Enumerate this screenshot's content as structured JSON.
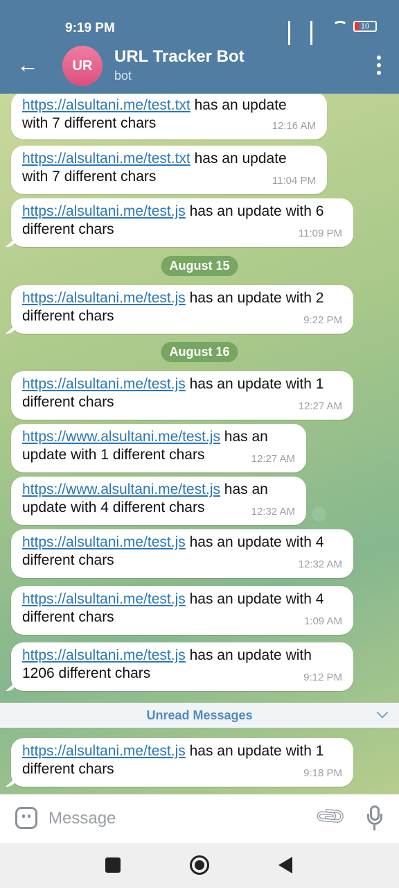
{
  "status_bar": {
    "time": "9:19 PM",
    "battery": "10"
  },
  "header": {
    "avatar_initials": "UR",
    "title": "URL Tracker Bot",
    "subtitle": "bot"
  },
  "messages": [
    {
      "link": "https://alsultani.me/test.txt",
      "text": " has an update with 7 different chars",
      "time": "12:16 AM"
    },
    {
      "link": "https://alsultani.me/test.txt",
      "text": " has an update with 7 different chars",
      "time": "11:04 PM"
    },
    {
      "link": "https://alsultani.me/test.js",
      "text": " has an update with 6 different chars",
      "time": "11:09 PM"
    },
    {
      "link": "https://alsultani.me/test.js",
      "text": " has an update with 2 different chars",
      "time": "9:22 PM"
    },
    {
      "link": "https://alsultani.me/test.js",
      "text": " has an update with 1 different chars",
      "time": "12:27 AM"
    },
    {
      "link": "https://www.alsultani.me/test.js",
      "text": " has an update with 1 different chars",
      "time": "12:27 AM"
    },
    {
      "link": "https://www.alsultani.me/test.js",
      "text": " has an update with 4 different chars",
      "time": "12:32 AM"
    },
    {
      "link": "https://alsultani.me/test.js",
      "text": " has an update with 4 different chars",
      "time": "12:32 AM"
    },
    {
      "link": "https://alsultani.me/test.js",
      "text": " has an update with 4 different chars",
      "time": "1:09 AM"
    },
    {
      "link": "https://alsultani.me/test.js",
      "text": " has an update with 1206 different chars",
      "time": "9:12 PM"
    },
    {
      "link": "https://alsultani.me/test.js",
      "text": " has an update with 1 different chars",
      "time": "9:18 PM"
    }
  ],
  "date_separators": [
    "August 15",
    "August 16"
  ],
  "unread_label": "Unread Messages",
  "input": {
    "placeholder": "Message"
  }
}
